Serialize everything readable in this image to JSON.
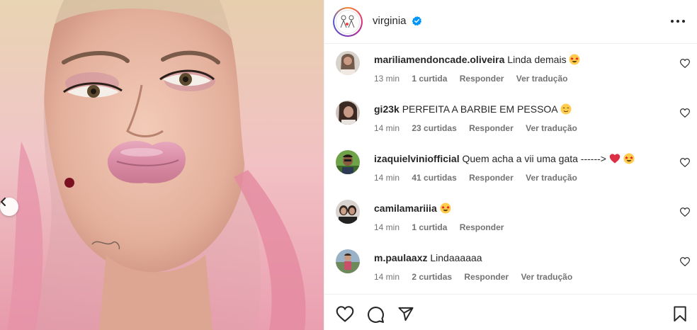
{
  "post": {
    "username": "virginia",
    "verified": true,
    "accent_gradient": [
      "#f58529",
      "#dd2a7b",
      "#8134af",
      "#515bd4"
    ],
    "verified_color": "#0095f6"
  },
  "comments": [
    {
      "user": "mariliamendoncade.oliveira",
      "text": "Linda demais",
      "emoji": [
        "star-struck"
      ],
      "time": "13 min",
      "likes": "1 curtida",
      "reply": "Responder",
      "translate": "Ver tradução"
    },
    {
      "user": "gi23k",
      "text": "PERFEITA A BARBIE EM PESSOA",
      "emoji": [
        "relieved-face"
      ],
      "time": "14 min",
      "likes": "23 curtidas",
      "reply": "Responder",
      "translate": "Ver tradução"
    },
    {
      "user": "izaquielviniofficial",
      "text": "Quem acha a vii uma gata ------>",
      "emoji": [
        "red-heart",
        "star-struck"
      ],
      "time": "14 min",
      "likes": "41 curtidas",
      "reply": "Responder",
      "translate": "Ver tradução"
    },
    {
      "user": "camilamariiia",
      "text": "",
      "emoji": [
        "star-struck"
      ],
      "time": "14 min",
      "likes": "1 curtida",
      "reply": "Responder",
      "translate": ""
    },
    {
      "user": "m.paulaaxz",
      "text": "Lindaaaaaa",
      "emoji": [],
      "time": "14 min",
      "likes": "2 curtidas",
      "reply": "Responder",
      "translate": "Ver tradução"
    }
  ],
  "icons": {
    "header": [
      "verified-badge-icon",
      "more-options-icon"
    ],
    "actions": [
      "heart-icon",
      "comment-icon",
      "share-icon",
      "bookmark-icon"
    ],
    "carousel": [
      "chevron-left-icon"
    ]
  }
}
